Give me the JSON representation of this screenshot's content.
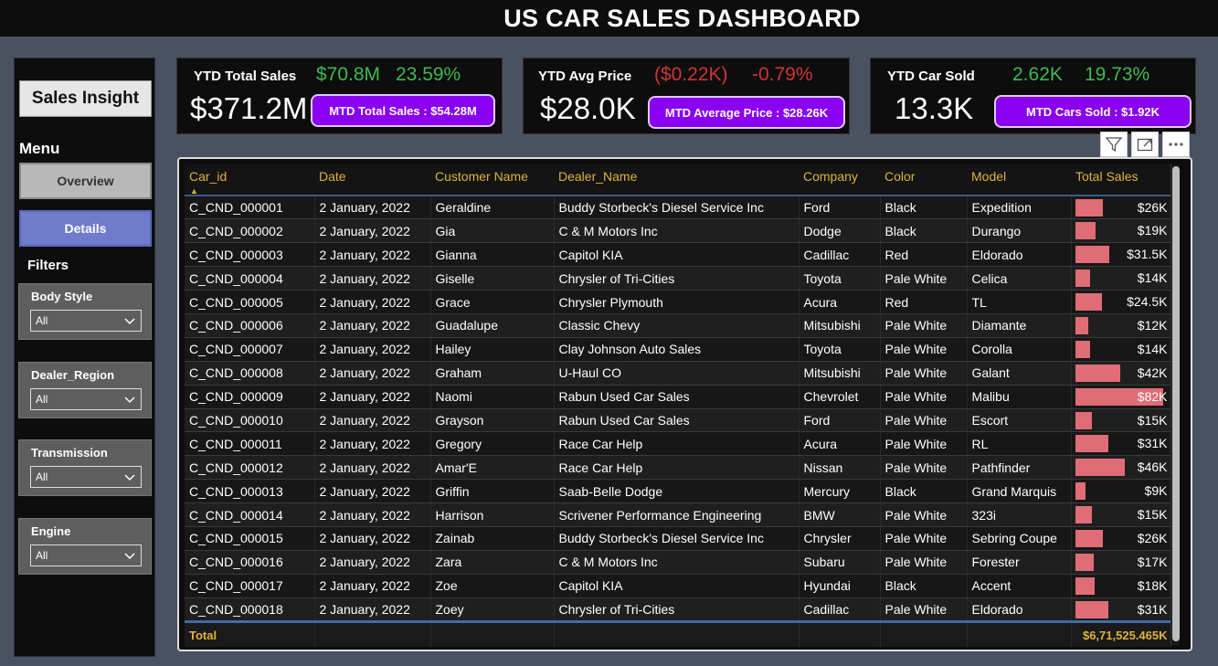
{
  "header": {
    "title": "US CAR SALES DASHBOARD"
  },
  "sidebar": {
    "brand": "Sales Insight",
    "menu_label": "Menu",
    "nav": [
      {
        "label": "Overview"
      },
      {
        "label": "Details"
      }
    ],
    "filters_label": "Filters",
    "filters": [
      {
        "label": "Body Style",
        "value": "All"
      },
      {
        "label": "Dealer_Region",
        "value": "All"
      },
      {
        "label": "Transmission",
        "value": "All"
      },
      {
        "label": "Engine",
        "value": "All"
      }
    ]
  },
  "kpis": [
    {
      "label": "YTD Total Sales",
      "value": "$371.2M",
      "metric1": "$70.8M",
      "metric1_color": "green",
      "metric2": "23.59%",
      "metric2_color": "green",
      "mtd": "MTD Total Sales : $54.28M"
    },
    {
      "label": "YTD Avg Price",
      "value": "$28.0K",
      "metric1": "($0.22K)",
      "metric1_color": "red",
      "metric2": "-0.79%",
      "metric2_color": "red",
      "mtd": "MTD Average Price : $28.26K"
    },
    {
      "label": "YTD Car Sold",
      "value": "13.3K",
      "metric1": "2.62K",
      "metric1_color": "green",
      "metric2": "19.73%",
      "metric2_color": "green",
      "mtd": "MTD Cars Sold : $1.92K"
    }
  ],
  "visual_icons": [
    "filter-icon",
    "focus-mode-icon",
    "more-options-icon"
  ],
  "colors": {
    "accent_purple": "#8a00f0",
    "header_gold": "#e0b23a",
    "bar": "#e06c75",
    "positive": "#3fb950",
    "negative": "#d03535"
  },
  "table": {
    "columns": [
      "Car_id",
      "Date",
      "Customer Name",
      "Dealer_Name",
      "Company",
      "Color",
      "Model",
      "Total Sales"
    ],
    "sort_column": "Car_id",
    "sort_direction": "ascending",
    "rows": [
      [
        "C_CND_000001",
        "2 January, 2022",
        "Geraldine",
        "Buddy Storbeck's Diesel Service Inc",
        "Ford",
        "Black",
        "Expedition",
        "$26K"
      ],
      [
        "C_CND_000002",
        "2 January, 2022",
        "Gia",
        "C & M Motors Inc",
        "Dodge",
        "Black",
        "Durango",
        "$19K"
      ],
      [
        "C_CND_000003",
        "2 January, 2022",
        "Gianna",
        "Capitol KIA",
        "Cadillac",
        "Red",
        "Eldorado",
        "$31.5K"
      ],
      [
        "C_CND_000004",
        "2 January, 2022",
        "Giselle",
        "Chrysler of Tri-Cities",
        "Toyota",
        "Pale White",
        "Celica",
        "$14K"
      ],
      [
        "C_CND_000005",
        "2 January, 2022",
        "Grace",
        "Chrysler Plymouth",
        "Acura",
        "Red",
        "TL",
        "$24.5K"
      ],
      [
        "C_CND_000006",
        "2 January, 2022",
        "Guadalupe",
        "Classic Chevy",
        "Mitsubishi",
        "Pale White",
        "Diamante",
        "$12K"
      ],
      [
        "C_CND_000007",
        "2 January, 2022",
        "Hailey",
        "Clay Johnson Auto Sales",
        "Toyota",
        "Pale White",
        "Corolla",
        "$14K"
      ],
      [
        "C_CND_000008",
        "2 January, 2022",
        "Graham",
        "U-Haul CO",
        "Mitsubishi",
        "Pale White",
        "Galant",
        "$42K"
      ],
      [
        "C_CND_000009",
        "2 January, 2022",
        "Naomi",
        "Rabun Used Car Sales",
        "Chevrolet",
        "Pale White",
        "Malibu",
        "$82K"
      ],
      [
        "C_CND_000010",
        "2 January, 2022",
        "Grayson",
        "Rabun Used Car Sales",
        "Ford",
        "Pale White",
        "Escort",
        "$15K"
      ],
      [
        "C_CND_000011",
        "2 January, 2022",
        "Gregory",
        "Race Car Help",
        "Acura",
        "Pale White",
        "RL",
        "$31K"
      ],
      [
        "C_CND_000012",
        "2 January, 2022",
        "Amar'E",
        "Race Car Help",
        "Nissan",
        "Pale White",
        "Pathfinder",
        "$46K"
      ],
      [
        "C_CND_000013",
        "2 January, 2022",
        "Griffin",
        "Saab-Belle Dodge",
        "Mercury",
        "Black",
        "Grand Marquis",
        "$9K"
      ],
      [
        "C_CND_000014",
        "2 January, 2022",
        "Harrison",
        "Scrivener Performance Engineering",
        "BMW",
        "Pale White",
        "323i",
        "$15K"
      ],
      [
        "C_CND_000015",
        "2 January, 2022",
        "Zainab",
        "Buddy Storbeck's Diesel Service Inc",
        "Chrysler",
        "Pale White",
        "Sebring Coupe",
        "$26K"
      ],
      [
        "C_CND_000016",
        "2 January, 2022",
        "Zara",
        "C & M Motors Inc",
        "Subaru",
        "Pale White",
        "Forester",
        "$17K"
      ],
      [
        "C_CND_000017",
        "2 January, 2022",
        "Zoe",
        "Capitol KIA",
        "Hyundai",
        "Black",
        "Accent",
        "$18K"
      ],
      [
        "C_CND_000018",
        "2 January, 2022",
        "Zoey",
        "Chrysler of Tri-Cities",
        "Cadillac",
        "Pale White",
        "Eldorado",
        "$31K"
      ]
    ],
    "sales_values_k": [
      26,
      19,
      31.5,
      14,
      24.5,
      12,
      14,
      42,
      82,
      15,
      31,
      46,
      9,
      15,
      26,
      17,
      18,
      31
    ],
    "total_label": "Total",
    "total_value": "$6,71,525.465K"
  }
}
